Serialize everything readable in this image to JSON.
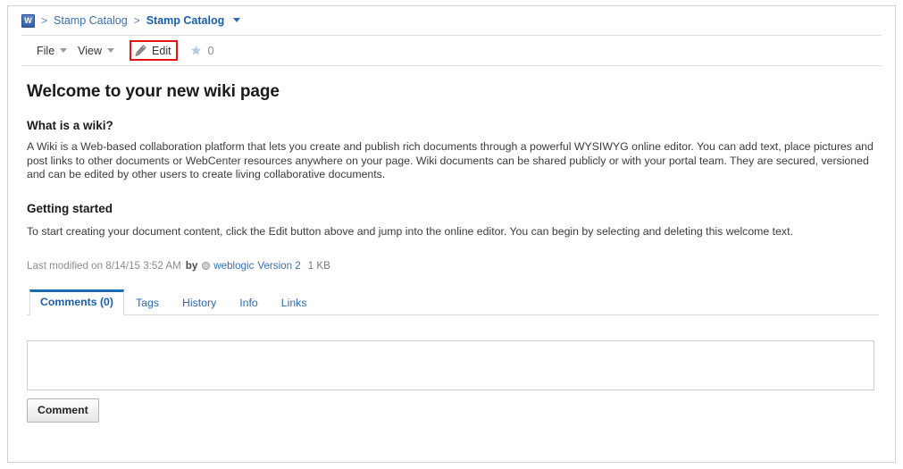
{
  "breadcrumb": {
    "badge_label": "W",
    "badge_icon": "wiki-page-icon",
    "separator": ">",
    "items": [
      {
        "label": "Stamp Catalog",
        "current": false
      },
      {
        "label": "Stamp Catalog",
        "current": true
      }
    ],
    "caret_icon": "chevron-down-icon"
  },
  "toolbar": {
    "file_label": "File",
    "view_label": "View",
    "edit_label": "Edit",
    "edit_icon": "pencil-icon",
    "star_icon": "star-icon",
    "star_count": "0",
    "highlight_color": "#e81414"
  },
  "content": {
    "title": "Welcome to your new wiki page",
    "section1_heading": "What is a wiki?",
    "section1_body": "A Wiki is a Web-based collaboration platform that lets you create and publish rich documents through a powerful WYSIWYG online editor. You can add text, place pictures and post links to other documents or WebCenter resources anywhere on your page. Wiki documents can be shared publicly or with your portal team. They are secured, versioned and can be edited by other users to create living collaborative documents.",
    "section2_heading": "Getting started",
    "section2_body": "To start creating your document content, click the Edit button above and jump into the online editor. You can begin by selecting and deleting this welcome text."
  },
  "last_modified": {
    "prefix": "Last modified on 8/14/15 3:52 AM",
    "by_label": "by",
    "presence_icon": "presence-indicator-icon",
    "user": "weblogic",
    "version": "Version 2",
    "size": "1 KB"
  },
  "tabs": [
    {
      "label": "Comments (0)",
      "active": true
    },
    {
      "label": "Tags",
      "active": false
    },
    {
      "label": "History",
      "active": false
    },
    {
      "label": "Info",
      "active": false
    },
    {
      "label": "Links",
      "active": false
    }
  ],
  "comment": {
    "input_value": "",
    "input_placeholder": "",
    "button_label": "Comment"
  },
  "colors": {
    "link": "#3a6fb0",
    "active_tab": "#1a6bb5",
    "page_border": "#c8d3de",
    "highlight": "#e81414"
  }
}
